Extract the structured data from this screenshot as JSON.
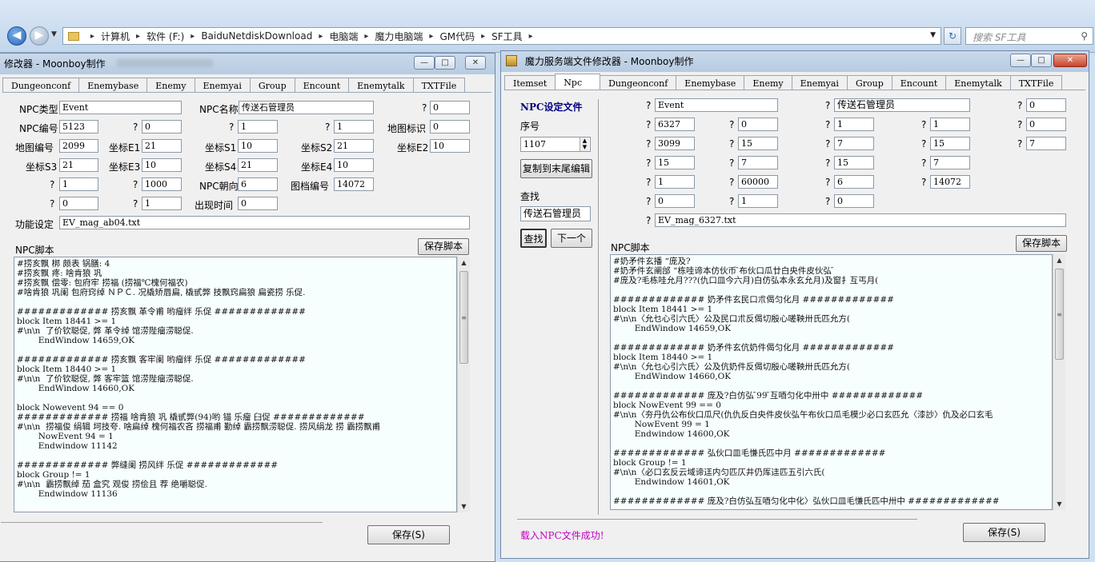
{
  "explorer": {
    "breadcrumb": [
      "计算机",
      "软件 (F:)",
      "BaiduNetdiskDownload",
      "电脑端",
      "魔力电脑端",
      "GM代码",
      "SF工具"
    ],
    "search_placeholder": "搜索 SF工具",
    "refresh_glyph": "↻"
  },
  "left": {
    "title": "修改器 - Moonboy制作",
    "tabs": [
      "Dungeonconf",
      "Enemybase",
      "Enemy",
      "Enemyai",
      "Group",
      "Encount",
      "Enemytalk",
      "TXTFile"
    ],
    "labels": {
      "npc_type": "NPC类型",
      "npc_name": "NPC名称",
      "q": "?",
      "npc_id": "NPC编号",
      "map_mark": "地图标识",
      "map_id": "地图编号",
      "e1": "坐标E1",
      "s1": "坐标S1",
      "s2": "坐标S2",
      "e2": "坐标E2",
      "s3": "坐标S3",
      "e3": "坐标E3",
      "s4": "坐标S4",
      "e4": "坐标E4",
      "dir": "NPC朝向",
      "img": "图档编号",
      "appear": "出现时间",
      "func": "功能设定",
      "script": "NPC脚本"
    },
    "values": {
      "npc_type": "Event",
      "npc_name": "传送石管理员",
      "r0": "0",
      "npc_id": "5123",
      "r1a": "0",
      "r1b": "1",
      "r1c": "1",
      "map_mark": "0",
      "map_id": "2099",
      "e1": "21",
      "s1": "10",
      "s2": "21",
      "e2": "10",
      "s3": "21",
      "e3": "10",
      "s4": "21",
      "e4": "10",
      "r4a": "1",
      "r4b": "1000",
      "dir": "6",
      "img": "14072",
      "r5a": "0",
      "r5b": "1",
      "appear": "0",
      "func": "EV_mag_ab04.txt"
    },
    "script_lines": [
      "#捞亥飘 梆 颇表 锅膳: 4",
      "#捞亥飘 疼: 啥肯狼 巩",
      "#捞亥飘 偿零: 包府牢 捞福 (捞福℃槐何福农)",
      "#啥肯狼 巩阑 包府窍绰 ＮＰＣ. 况橇矫唇扁, 橇甙弊 技飘窍扁狼 扁瓷捞 乐促.",
      "",
      "############# 捞亥飘 革令甫 哟瘤绊 乐促 #############",
      "block Item 18441 >= 1",
      "#\\n\\n  了价钦聪促, 弊 革令绰 馆涝陛瘤涝聪促.",
      "        EndWindow 14659,OK",
      "",
      "############# 捞亥飘 客牢阑 哟瘤绊 乐促 #############",
      "block Item 18440 >= 1",
      "#\\n\\n  了价钦聪促, 弊 客牢篮 馆涝陛瘤涝聪促.",
      "        EndWindow 14660,OK",
      "",
      "block Nowevent 94 == 0",
      "############# 捞福 啥肯狼 巩 橇甙弊(94)哟 锚 乐瘤 臼促 #############",
      "#\\n\\n  捞福俊 绢辑 坷技夸. 啥扁绰 槐何福农吝 捞福甫 勤绰 霸捞飘涝聪促. 捞风绢龙 捞 霸捞飘甫",
      "        NowEvent 94 = 1",
      "        Endwindow 11142",
      "",
      "############# 弊缝阑 捞风绊 乐促 #############",
      "block Group != 1",
      "#\\n\\n  霸捞飘绰 茄 盒究 观俊 捞侩且 荐 绝嚼聪促.",
      "        Endwindow 11136"
    ],
    "save_script": "保存脚本",
    "save": "保存(S)",
    "min_glyph": "—",
    "max_glyph": "□",
    "close_glyph": "✕"
  },
  "right": {
    "title": "魔力服务端文件修改器 - Moonboy制作",
    "tabs": [
      "Itemset",
      "Npc",
      "Dungeonconf",
      "Enemybase",
      "Enemy",
      "Enemyai",
      "Group",
      "Encount",
      "Enemytalk",
      "TXTFile"
    ],
    "active_tab": "Npc",
    "npc_file_label": "NPC设定文件",
    "seq_label": "序号",
    "seq_value": "1107",
    "copy_button": "复制到末尾编辑",
    "find_label": "查找",
    "find_value": "传送石管理员",
    "find_button": "查找",
    "next_button": "下一个",
    "q": "?",
    "values": {
      "a1": "Event",
      "a2": "传送石管理员",
      "a3": "0",
      "b1": "6327",
      "b2": "0",
      "b3": "1",
      "b4": "1",
      "b5": "0",
      "c1": "3099",
      "c2": "15",
      "c3": "7",
      "c4": "15",
      "c5": "7",
      "d1": "15",
      "d2": "7",
      "d3": "15",
      "d4": "7",
      "e1": "1",
      "e2": "60000",
      "e3": "6",
      "e4": "14072",
      "f1": "0",
      "f2": "1",
      "f3": "0",
      "g1": "EV_mag_6327.txt"
    },
    "script_label": "NPC脚本",
    "save_script": "保存脚本",
    "script_lines": [
      "#奶矛件玄播 “庞及?",
      "#奶矛件玄阐邰 “栋哇谛本仿伙币 ̄布伙口瓜廿白央件皮伙弘 ̄",
      "#庞及?毛栋哇允月???(仇口皿今六月)白仿弘本永玄允月)及窗扌互丐月(",
      "",
      "############# 奶矛件玄民口朮偈匀化月 #############",
      "block Item 18441 >= 1",
      "#\\n\\n〈允乜心引六氏〉公及民口朮反偈切殷心嗟鞅卅氏匹允方(",
      "        EndWindow 14659,OK",
      "",
      "############# 奶矛件玄伉奶件偈匀化月 #############",
      "block Item 18440 >= 1",
      "#\\n\\n〈允乜心引六氏〉公及伉奶件反偈切殷心嗟鞅卅氏匹允方(",
      "        EndWindow 14660,OK",
      "",
      "############# 庞及?白仿弘 ̄99 ̄互唒匀化中卅中 #############",
      "block NowEvent 99 == 0",
      "#\\n\\n〈夯丹仇公布伙口瓜尺(仇仇反白央件皮伙弘午布伙口瓜毛模少必口玄匹允〈漆訬〉仇及必口玄毛",
      "        NowEvent 99 = 1",
      "        Endwindow 14600,OK",
      "",
      "############# 弘伙口皿毛慊氏匹中月 #############",
      "block Group != 1",
      "#\\n\\n〈必口玄反云域谛迋内匀匹仄井仍厍迬匹五引六氏(",
      "        Endwindow 14601,OK",
      "",
      "############# 庞及?白仿弘互唒匀化中化〉弘伙口皿毛慊氏匹中卅中 #############"
    ],
    "status": "载入NPC文件成功!",
    "save": "保存(S)",
    "min_glyph": "—",
    "max_glyph": "□",
    "close_glyph": "✕"
  },
  "colors": {
    "status_magenta": "#c000c0",
    "script_bg": "#f7fffe",
    "header_navy": "#000080"
  }
}
